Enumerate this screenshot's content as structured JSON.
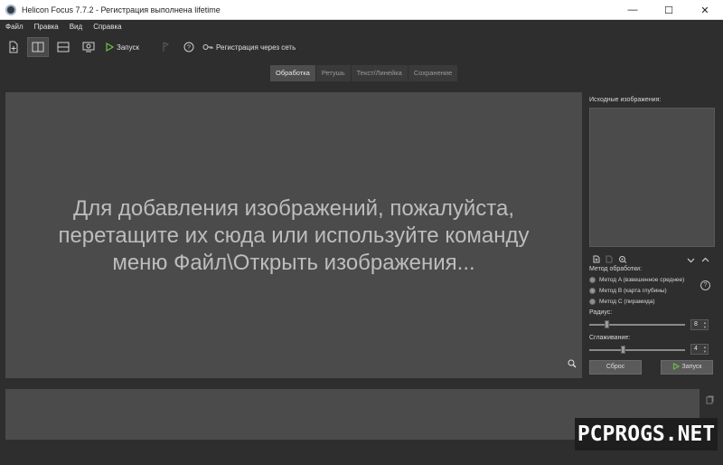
{
  "window": {
    "title": "Helicon Focus 7.7.2 - Регистрация выполнена  lifetime",
    "min_glyph": "—",
    "max_glyph": "☐",
    "close_glyph": "✕"
  },
  "menu": {
    "items": [
      "Файл",
      "Правка",
      "Вид",
      "Справка"
    ]
  },
  "toolbar": {
    "run_label": "Запуск",
    "register_label": "Регистрация через сеть",
    "help_glyph": "?",
    "icons": [
      "add-file-icon",
      "split-vertical-icon",
      "split-horizontal-icon",
      "screen-icon",
      "play-icon",
      "flag-icon",
      "help-icon",
      "key-icon"
    ]
  },
  "tabs": [
    "Обработка",
    "Ретушь",
    "Текст/Линейка",
    "Сохранение"
  ],
  "main": {
    "drop_message_lines": [
      "Для добавления изображений, пожалуйста,",
      "перетащите их сюда или используйте команду",
      "меню Файл\\Открыть изображения..."
    ]
  },
  "panel": {
    "source_label": "Исходные изображения:",
    "method_label": "Метод обработки:",
    "methods": [
      "Метод A (взвешенное среднее)",
      "Метод B (карта глубины)",
      "Метод C (пирамида)"
    ],
    "selected_method_index": 1,
    "radius_label": "Радиус:",
    "radius_value": "8",
    "smoothing_label": "Сглаживание:",
    "smoothing_value": "4",
    "radius_fraction": 0.16,
    "smoothing_fraction": 0.33,
    "reset_label": "Сброс",
    "run_label": "Запуск",
    "help_glyph": "?"
  },
  "watermark": "PCPROGS.NET",
  "colors": {
    "accent_green": "#6fbf4a",
    "background": "#2e2e2e",
    "panel": "#4b4b4b"
  }
}
